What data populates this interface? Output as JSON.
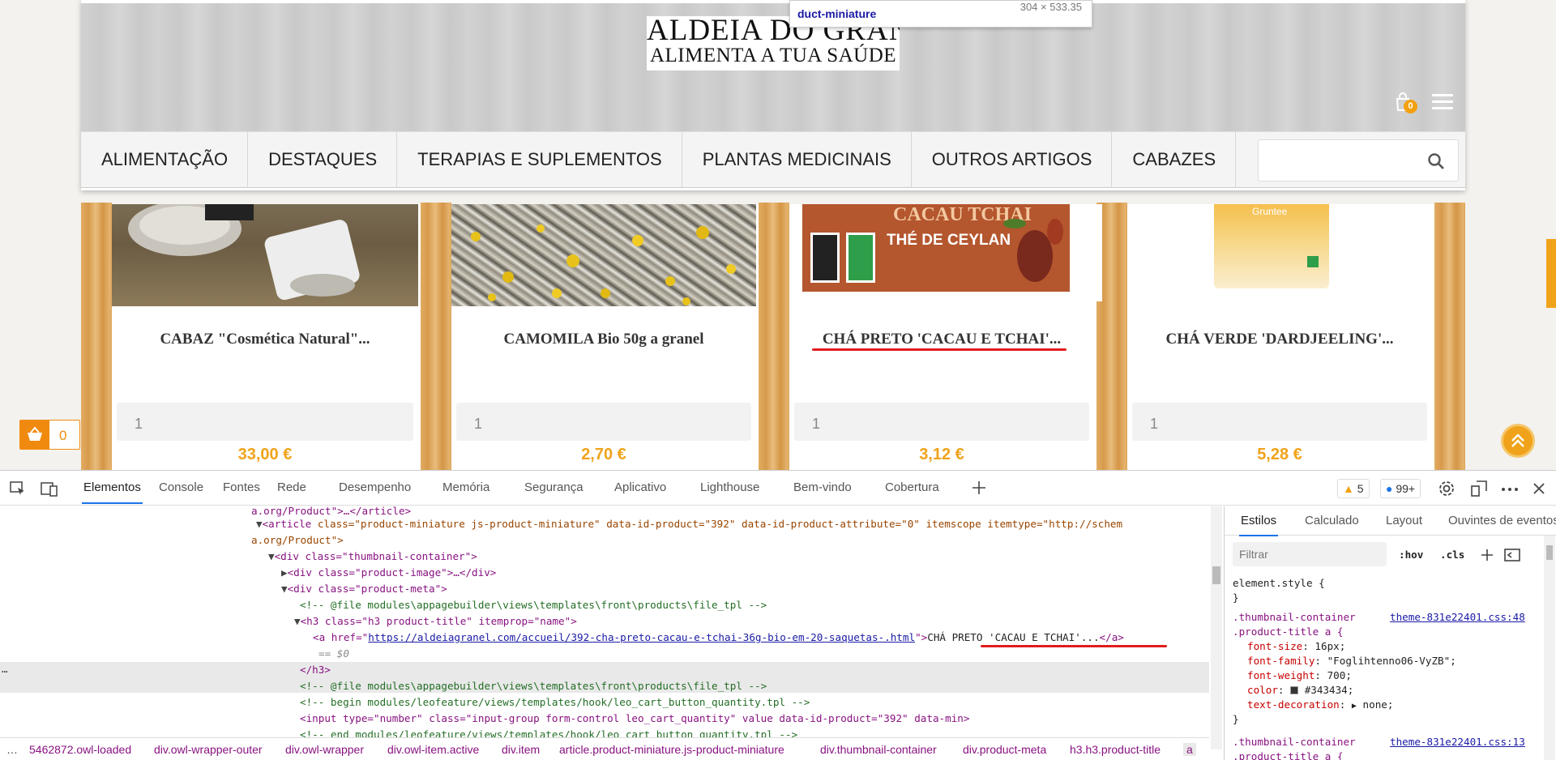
{
  "site": {
    "logo": {
      "line1": "ALDEIA DO GRANEL",
      "line2": "ALIMENTA A TUA SAÚDE"
    },
    "tooltip": {
      "name": "duct-miniature",
      "size": "304 × 533.35"
    },
    "cart_count": "0",
    "nav": [
      "ALIMENTAÇÃO",
      "DESTAQUES",
      "TERAPIAS E SUPLEMENTOS",
      "PLANTAS MEDICINAIS",
      "OUTROS ARTIGOS",
      "CABAZES"
    ],
    "products": [
      {
        "title": "CABAZ \"Cosmética Natural\"...",
        "qty": "1",
        "price": "33,00 €"
      },
      {
        "title": "CAMOMILA Bio 50g a granel",
        "qty": "1",
        "price": "2,70 €"
      },
      {
        "title": "CHÁ PRETO 'CACAU E TCHAI'...",
        "qty": "1",
        "price": "3,12 €",
        "image_text": "CACAU TCHAI",
        "image_subtext": "THÉ DE CEYLAN"
      },
      {
        "title": "CHÁ VERDE 'DARDJEELING'...",
        "qty": "1",
        "price": "5,28 €",
        "image_text": "Gruntee"
      }
    ],
    "floating_cart_count": "0",
    "colors": {
      "accent": "#f0a31a",
      "title_text": "#343434",
      "highlight": "#e01c1c"
    }
  },
  "devtools": {
    "tabs": [
      "Elementos",
      "Console",
      "Fontes",
      "Rede",
      "Desempenho",
      "Memória",
      "Segurança",
      "Aplicativo",
      "Lighthouse",
      "Bem-vindo",
      "Cobertura"
    ],
    "warnings": "5",
    "messages": "99+",
    "code": {
      "l0": "a.org/Product\">…</article>",
      "l1a": "<article ",
      "l1b": "class=\"product-miniature js-product-miniature\" data-id-product=\"392\" data-id-product-attribute=\"0\" itemscope itemtype=\"http://schem",
      "l2": "a.org/Product\">",
      "l3": "<div class=\"thumbnail-container\">",
      "l4": "<div class=\"product-image\">…</div>",
      "l5": "<div class=\"product-meta\">",
      "l6": "<!-- @file modules\\appagebuilder\\views\\templates\\front\\products\\file_tpl -->",
      "l7": "<h3 class=\"h3 product-title\" itemprop=\"name\">",
      "l8a": "<a href=\"",
      "l8b": "https://aldeiagranel.com/accueil/392-cha-preto-cacau-e-tchai-36g-bio-em-20-saquetas-.html",
      "l8c": "\">",
      "l8d": "CHÁ PRETO 'CACAU E TCHAI'...",
      "l8e": "</a>",
      "l9": "== $0",
      "l10": "</h3>",
      "l11": "<!-- @file modules\\appagebuilder\\views\\templates\\front\\products\\file_tpl -->",
      "l12": "<!-- begin modules/leofeature/views/templates/hook/leo_cart_button_quantity.tpl -->",
      "l13": "<input type=\"number\" class=\"input-group form-control leo_cart_quantity\" value data-id-product=\"392\" data-min>",
      "l14": "<!-- end modules/leofeature/views/templates/hook/leo_cart_button_quantity.tpl -->"
    },
    "breadcrumbs": [
      "5462872.owl-loaded",
      "div.owl-wrapper-outer",
      "div.owl-wrapper",
      "div.owl-item.active",
      "div.item",
      "article.product-miniature.js-product-miniature",
      "div.thumbnail-container",
      "div.product-meta",
      "h3.h3.product-title",
      "a"
    ],
    "styles": {
      "tabs": [
        "Estilos",
        "Calculado",
        "Layout",
        "Ouvintes de eventos"
      ],
      "filter_placeholder": "Filtrar",
      "hov": ":hov",
      "cls": ".cls",
      "element_style": "element.style {",
      "close_brace": "}",
      "rule1_selector_a": ".thumbnail-container",
      "rule1_selector_b": ".product-title a {",
      "rule1_link": "theme-831e22401.css:48",
      "decls": [
        {
          "prop": "font-size",
          "val": "16px;"
        },
        {
          "prop": "font-family",
          "val": "\"Foglihtenno06-VyZB\";"
        },
        {
          "prop": "font-weight",
          "val": "700;"
        },
        {
          "prop": "color",
          "val": "#343434;"
        },
        {
          "prop": "text-decoration",
          "val": "none;"
        }
      ],
      "rule2_selector_a": ".thumbnail-container",
      "rule2_selector_b": ".product-title a {",
      "rule2_link": "theme-831e22401.css:13"
    }
  }
}
